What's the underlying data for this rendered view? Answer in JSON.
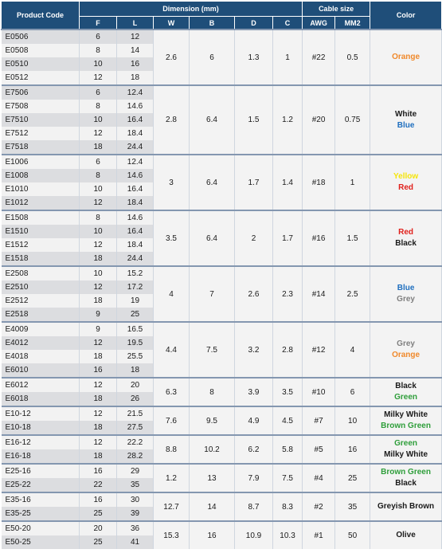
{
  "table": {
    "headers": {
      "product_code": "Product Code",
      "dimension": "Dimension (mm)",
      "cable_size": "Cable size",
      "color": "Color",
      "sub": [
        "F",
        "L",
        "W",
        "B",
        "D",
        "C",
        "AWG",
        "MM2"
      ]
    },
    "color_map": {
      "Orange": "#f0892b",
      "White": "#1a1a1a",
      "Blue": "#1f6fbf",
      "Yellow": "#f5e50a",
      "Red": "#e0201b",
      "Black": "#1a1a1a",
      "Grey": "#7f7f7f",
      "Green": "#2e9e3a",
      "Milky White": "#1a1a1a",
      "Brown Green": "#2e9e3a",
      "Greyish Brown": "#1a1a1a",
      "Olive": "#1a1a1a"
    },
    "groups": [
      {
        "w": "2.6",
        "b": "6",
        "d": "1.3",
        "c": "1",
        "awg": "#22",
        "mm2": "0.5",
        "colors": [
          "Orange"
        ],
        "rows": [
          {
            "code": "E0506",
            "f": "6",
            "l": "12"
          },
          {
            "code": "E0508",
            "f": "8",
            "l": "14"
          },
          {
            "code": "E0510",
            "f": "10",
            "l": "16"
          },
          {
            "code": "E0512",
            "f": "12",
            "l": "18"
          }
        ]
      },
      {
        "w": "2.8",
        "b": "6.4",
        "d": "1.5",
        "c": "1.2",
        "awg": "#20",
        "mm2": "0.75",
        "colors": [
          "White",
          "Blue"
        ],
        "rows": [
          {
            "code": "E7506",
            "f": "6",
            "l": "12.4"
          },
          {
            "code": "E7508",
            "f": "8",
            "l": "14.6"
          },
          {
            "code": "E7510",
            "f": "10",
            "l": "16.4"
          },
          {
            "code": "E7512",
            "f": "12",
            "l": "18.4"
          },
          {
            "code": "E7518",
            "f": "18",
            "l": "24.4"
          }
        ]
      },
      {
        "w": "3",
        "b": "6.4",
        "d": "1.7",
        "c": "1.4",
        "awg": "#18",
        "mm2": "1",
        "colors": [
          "Yellow",
          "Red"
        ],
        "rows": [
          {
            "code": "E1006",
            "f": "6",
            "l": "12.4"
          },
          {
            "code": "E1008",
            "f": "8",
            "l": "14.6"
          },
          {
            "code": "E1010",
            "f": "10",
            "l": "16.4"
          },
          {
            "code": "E1012",
            "f": "12",
            "l": "18.4"
          }
        ]
      },
      {
        "w": "3.5",
        "b": "6.4",
        "d": "2",
        "c": "1.7",
        "awg": "#16",
        "mm2": "1.5",
        "colors": [
          "Red",
          "Black"
        ],
        "rows": [
          {
            "code": "E1508",
            "f": "8",
            "l": "14.6"
          },
          {
            "code": "E1510",
            "f": "10",
            "l": "16.4"
          },
          {
            "code": "E1512",
            "f": "12",
            "l": "18.4"
          },
          {
            "code": "E1518",
            "f": "18",
            "l": "24.4"
          }
        ]
      },
      {
        "w": "4",
        "b": "7",
        "d": "2.6",
        "c": "2.3",
        "awg": "#14",
        "mm2": "2.5",
        "colors": [
          "Blue",
          "Grey"
        ],
        "rows": [
          {
            "code": "E2508",
            "f": "10",
            "l": "15.2"
          },
          {
            "code": "E2510",
            "f": "12",
            "l": "17.2"
          },
          {
            "code": "E2512",
            "f": "18",
            "l": "19"
          },
          {
            "code": "E2518",
            "f": "9",
            "l": "25"
          }
        ]
      },
      {
        "w": "4.4",
        "b": "7.5",
        "d": "3.2",
        "c": "2.8",
        "awg": "#12",
        "mm2": "4",
        "colors": [
          "Grey",
          "Orange"
        ],
        "rows": [
          {
            "code": "E4009",
            "f": "9",
            "l": "16.5"
          },
          {
            "code": "E4012",
            "f": "12",
            "l": "19.5"
          },
          {
            "code": "E4018",
            "f": "18",
            "l": "25.5"
          },
          {
            "code": "E6010",
            "f": "16",
            "l": "18"
          }
        ]
      },
      {
        "w": "6.3",
        "b": "8",
        "d": "3.9",
        "c": "3.5",
        "awg": "#10",
        "mm2": "6",
        "colors": [
          "Black",
          "Green"
        ],
        "rows": [
          {
            "code": "E6012",
            "f": "12",
            "l": "20"
          },
          {
            "code": "E6018",
            "f": "18",
            "l": "26"
          }
        ]
      },
      {
        "w": "7.6",
        "b": "9.5",
        "d": "4.9",
        "c": "4.5",
        "awg": "#7",
        "mm2": "10",
        "colors": [
          "Milky White",
          "Brown Green"
        ],
        "rows": [
          {
            "code": "E10-12",
            "f": "12",
            "l": "21.5"
          },
          {
            "code": "E10-18",
            "f": "18",
            "l": "27.5"
          }
        ]
      },
      {
        "w": "8.8",
        "b": "10.2",
        "d": "6.2",
        "c": "5.8",
        "awg": "#5",
        "mm2": "16",
        "colors": [
          "Green",
          "Milky White"
        ],
        "rows": [
          {
            "code": "E16-12",
            "f": "12",
            "l": "22.2"
          },
          {
            "code": "E16-18",
            "f": "18",
            "l": "28.2"
          }
        ]
      },
      {
        "w": "1.2",
        "b": "13",
        "d": "7.9",
        "c": "7.5",
        "awg": "#4",
        "mm2": "25",
        "colors": [
          "Brown Green",
          "Black"
        ],
        "rows": [
          {
            "code": "E25-16",
            "f": "16",
            "l": "29"
          },
          {
            "code": "E25-22",
            "f": "22",
            "l": "35"
          }
        ]
      },
      {
        "w": "12.7",
        "b": "14",
        "d": "8.7",
        "c": "8.3",
        "awg": "#2",
        "mm2": "35",
        "colors": [
          "Greyish Brown"
        ],
        "rows": [
          {
            "code": "E35-16",
            "f": "16",
            "l": "30"
          },
          {
            "code": "E35-25",
            "f": "25",
            "l": "39"
          }
        ]
      },
      {
        "w": "15.3",
        "b": "16",
        "d": "10.9",
        "c": "10.3",
        "awg": "#1",
        "mm2": "50",
        "colors": [
          "Olive"
        ],
        "rows": [
          {
            "code": "E50-20",
            "f": "20",
            "l": "36"
          },
          {
            "code": "E50-25",
            "f": "25",
            "l": "41"
          }
        ]
      }
    ]
  }
}
